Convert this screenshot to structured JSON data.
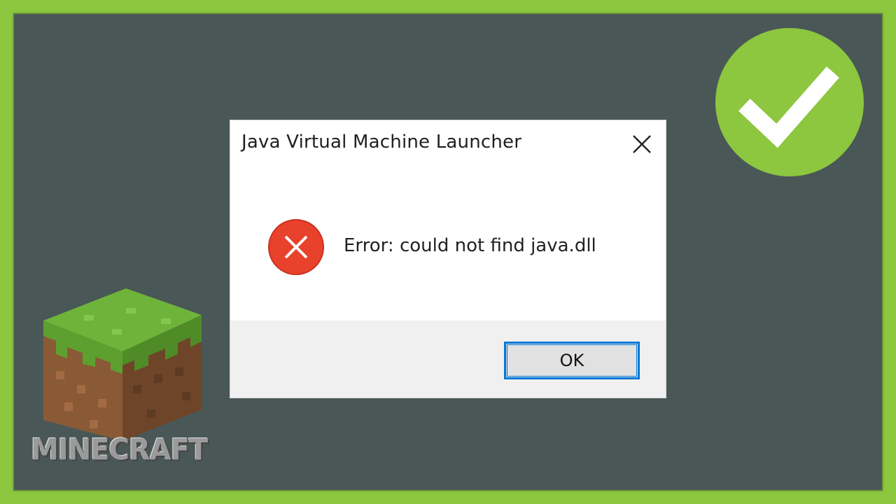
{
  "dialog": {
    "title": "Java Virtual Machine Launcher",
    "message": "Error: could not find java.dll",
    "ok_label": "OK"
  },
  "logo": {
    "wordmark": "MINECRAFT"
  },
  "icons": {
    "close": "close-icon",
    "error": "error-icon",
    "check": "checkmark-icon",
    "grass_block": "grass-block-icon"
  },
  "colors": {
    "frame_green": "#8dc63f",
    "background": "#4a5757",
    "error_red": "#e8412c",
    "focus_blue": "#0078d7"
  }
}
